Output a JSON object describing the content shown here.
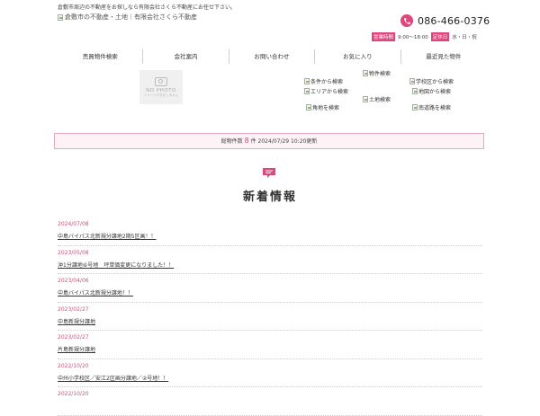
{
  "header": {
    "tagline": "倉敷市周辺の不動産をお探しなら有限会社さくら不動産にお任せ下さい。",
    "logo_alt": "倉敷市の不動産・土地｜有限会社さくら不動産",
    "phone": "086-466-0376",
    "hours_label": "営業時間",
    "hours_value": "9:00～18:00",
    "holiday_label": "定休日",
    "holiday_value": "水・日・祝"
  },
  "nav": [
    "売買物件検索",
    "会社案内",
    "お問い合わせ",
    "お気に入り",
    "最近見た物件"
  ],
  "nophoto": {
    "title": "NO PHOTO",
    "sub": "イメージが存在しません"
  },
  "search_links": {
    "property": "物件検索",
    "conditions": "条件から検索",
    "school": "学校区から検索",
    "area": "エリアから検索",
    "map": "地図から検索",
    "land": "土地検索",
    "corner": "角地を検索",
    "south_road": "南道路を検索"
  },
  "count": {
    "prefix": "総物件数",
    "number": "8",
    "unit": "件",
    "updated": "2024/07/29 10:20更新"
  },
  "news": {
    "title": "新着情報",
    "items": [
      {
        "date": "2024/07/08",
        "text": "中島バイパス北新規分譲地2期5区画！！"
      },
      {
        "date": "2023/05/08",
        "text": "沖1分譲地⑥号地　坪単価変更になりました！！"
      },
      {
        "date": "2023/04/06",
        "text": "中島バイパス北新規分譲地！！"
      },
      {
        "date": "2023/02/27",
        "text": "中島新規分譲地"
      },
      {
        "date": "2023/02/27",
        "text": "片島新規分譲地"
      },
      {
        "date": "2022/10/20",
        "text": "中州小学校区／安江2区画分譲地／②号地！！"
      },
      {
        "date": "2022/10/20",
        "text": ""
      }
    ]
  },
  "colors": {
    "accent": "#e0457b"
  }
}
